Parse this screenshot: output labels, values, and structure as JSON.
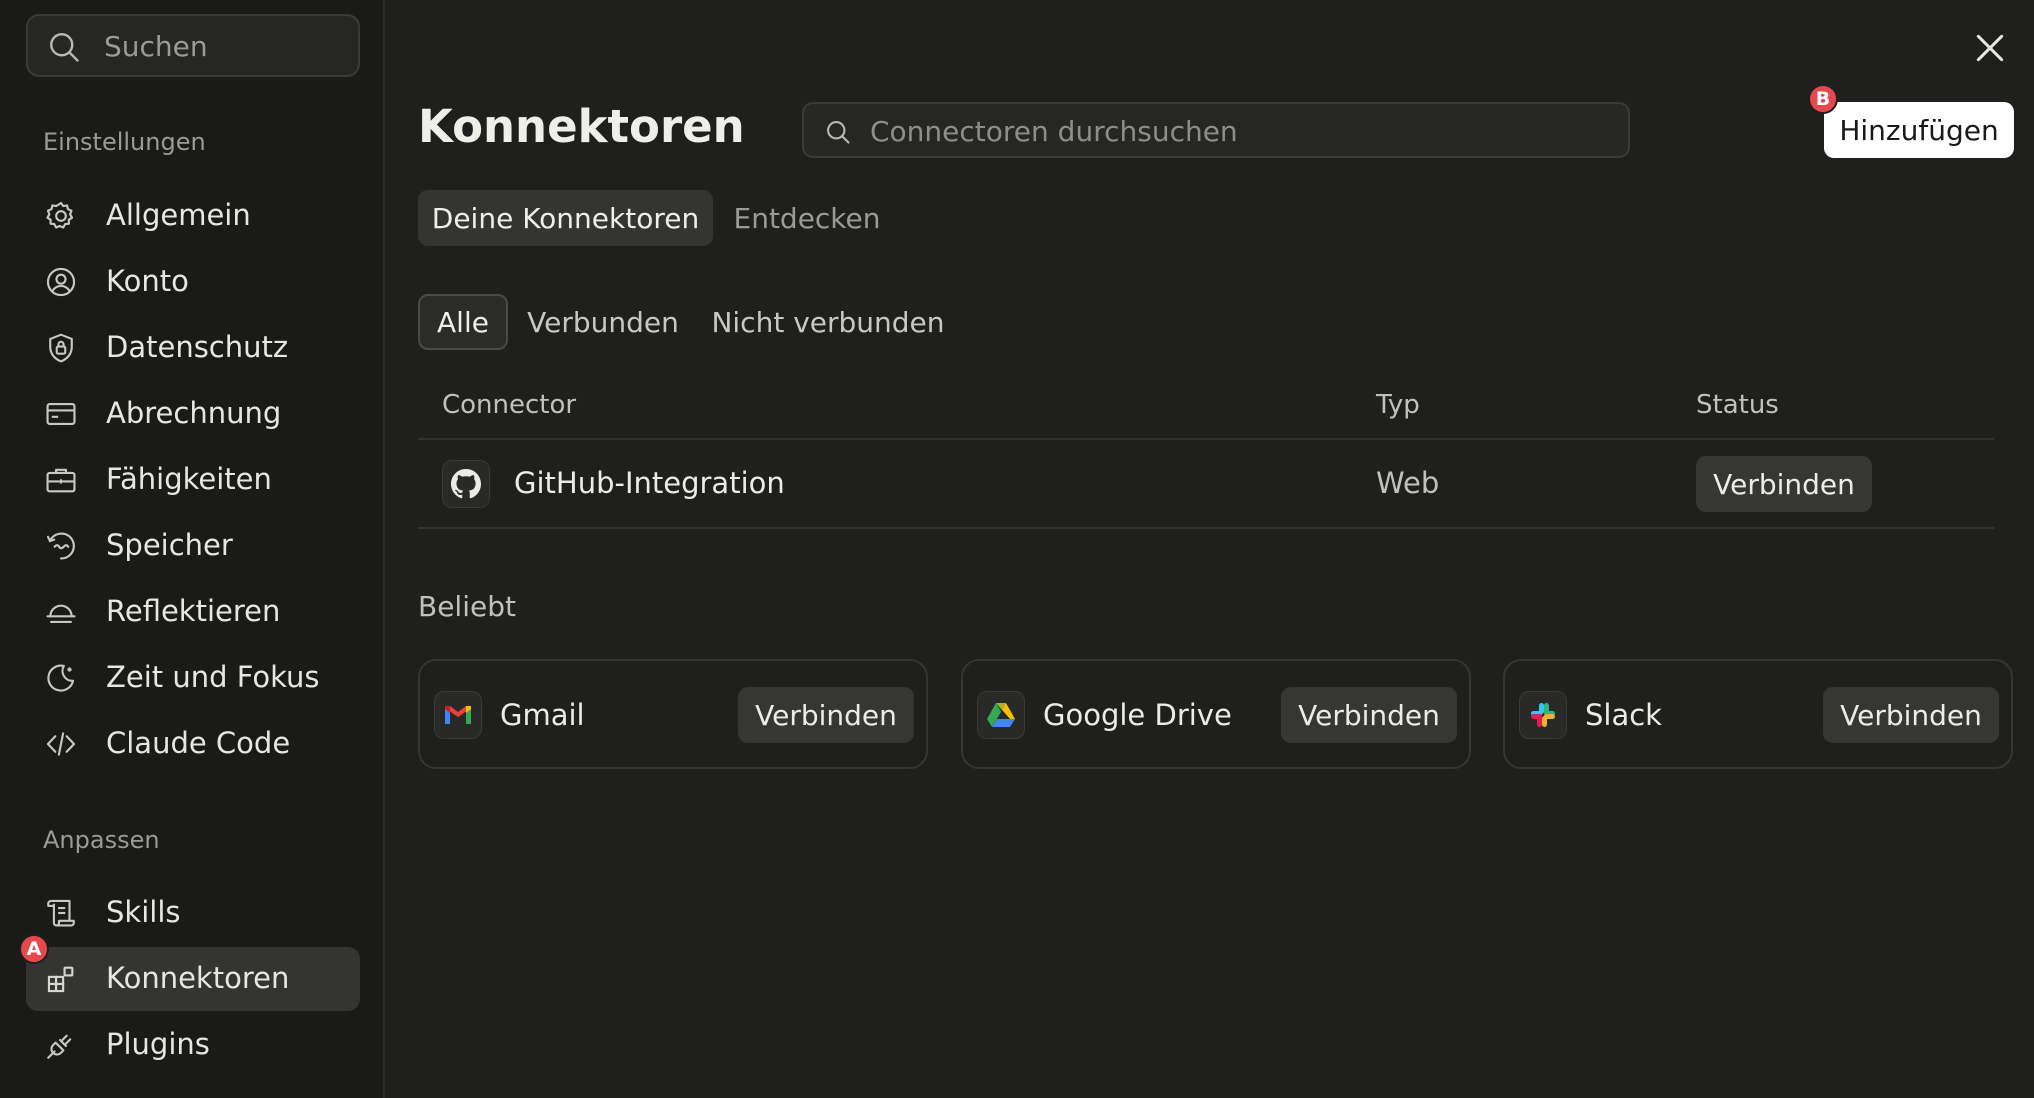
{
  "sidebar": {
    "search_placeholder": "Suchen",
    "section_settings": "Einstellungen",
    "section_customize": "Anpassen",
    "settings_items": [
      {
        "label": "Allgemein",
        "icon": "gear-icon"
      },
      {
        "label": "Konto",
        "icon": "user-circle-icon"
      },
      {
        "label": "Datenschutz",
        "icon": "shield-lock-icon"
      },
      {
        "label": "Abrechnung",
        "icon": "credit-card-icon"
      },
      {
        "label": "Fähigkeiten",
        "icon": "briefcase-icon"
      },
      {
        "label": "Speicher",
        "icon": "memory-icon"
      },
      {
        "label": "Reflektieren",
        "icon": "reflect-icon"
      },
      {
        "label": "Zeit und Fokus",
        "icon": "moon-icon"
      },
      {
        "label": "Claude Code",
        "icon": "code-icon"
      }
    ],
    "customize_items": [
      {
        "label": "Skills",
        "icon": "scroll-icon"
      },
      {
        "label": "Konnektoren",
        "icon": "connectors-icon",
        "active": true
      },
      {
        "label": "Plugins",
        "icon": "plug-icon"
      }
    ],
    "marker": "A"
  },
  "main": {
    "title": "Konnektoren",
    "search_placeholder": "Connectoren durchsuchen",
    "add_label": "Hinzufügen",
    "add_marker": "B",
    "tabs": [
      {
        "label": "Deine Konnektoren",
        "active": true
      },
      {
        "label": "Entdecken",
        "active": false
      }
    ],
    "filters": [
      {
        "label": "Alle",
        "active": true
      },
      {
        "label": "Verbunden",
        "active": false
      },
      {
        "label": "Nicht verbunden",
        "active": false
      }
    ],
    "table": {
      "headers": [
        "Connector",
        "Typ",
        "Status"
      ],
      "rows": [
        {
          "name": "GitHub-Integration",
          "type": "Web",
          "action": "Verbinden",
          "icon": "github-icon"
        }
      ]
    },
    "popular_label": "Beliebt",
    "popular": [
      {
        "name": "Gmail",
        "action": "Verbinden",
        "icon": "gmail-icon"
      },
      {
        "name": "Google Drive",
        "action": "Verbinden",
        "icon": "google-drive-icon"
      },
      {
        "name": "Slack",
        "action": "Verbinden",
        "icon": "slack-icon"
      }
    ]
  },
  "colors": {
    "background": "#1f1f1e",
    "sidebar": "#1a1a19",
    "active_item": "#343432",
    "marker": "#e5484d",
    "primary_button": "#ffffff"
  }
}
